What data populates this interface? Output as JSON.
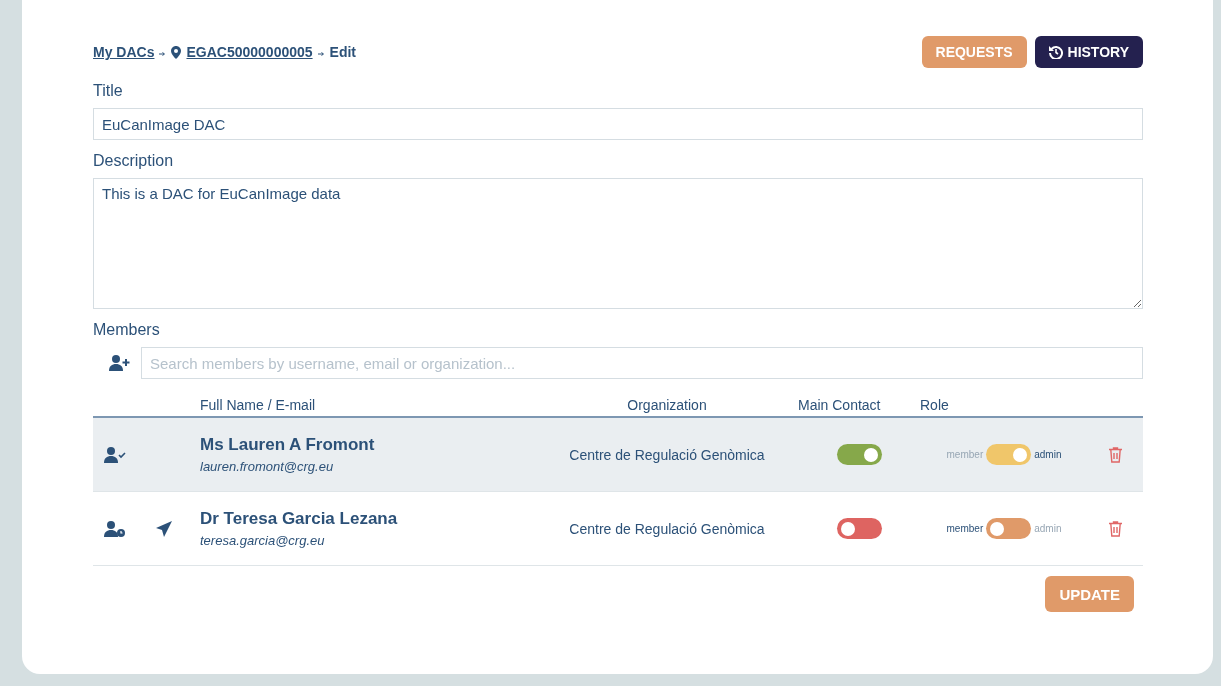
{
  "breadcrumb": [
    {
      "label": "My DACs",
      "kind": "link"
    },
    {
      "label": "EGAC50000000005",
      "kind": "pin-link"
    },
    {
      "label": "Edit",
      "kind": "text"
    }
  ],
  "header_buttons": [
    {
      "label": "REQUESTS",
      "kind": "requests"
    },
    {
      "label": "HISTORY",
      "kind": "history"
    }
  ],
  "title_field": {
    "label": "Title",
    "value": "EuCanImage DAC"
  },
  "description_field": {
    "label": "Description",
    "value": "This is a DAC for EuCanImage data"
  },
  "members": {
    "label": "Members",
    "search": {
      "placeholder": "Search members by username, email or organization..."
    },
    "columns": [
      "Full Name / E-mail",
      "Organization",
      "Main Contact",
      "Role"
    ],
    "rows": [
      {
        "kind": "confirmed",
        "invite_sent": false,
        "selected": true,
        "name": "Ms Lauren A Fromont",
        "email": "lauren.fromont@crg.eu",
        "organization": "Centre de Regulació Genòmica",
        "main_contact": true,
        "role_member_label": "member",
        "role_admin_label": "admin",
        "admin": true
      },
      {
        "kind": "pending",
        "invite_sent": true,
        "selected": false,
        "name": "Dr Teresa Garcia Lezana",
        "email": "teresa.garcia@crg.eu",
        "organization": "Centre de Regulació Genòmica",
        "main_contact": false,
        "role_member_label": "member",
        "role_admin_label": "admin",
        "admin": false
      }
    ]
  },
  "update_button": {
    "label": "UPDATE"
  }
}
